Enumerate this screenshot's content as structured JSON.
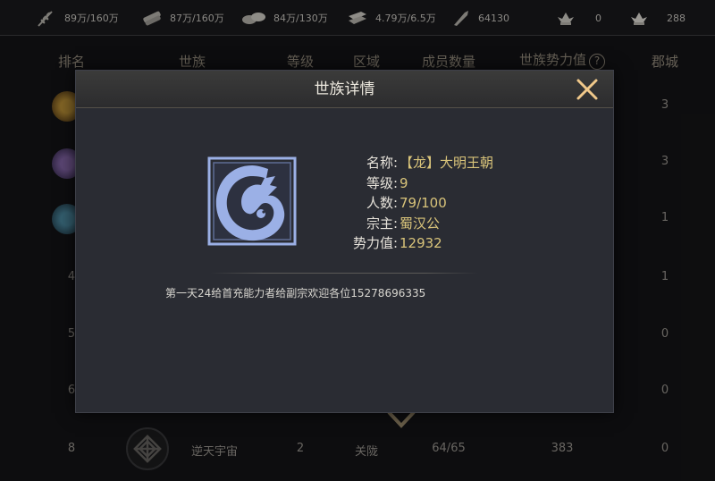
{
  "resources": [
    {
      "icon": "wheat-icon",
      "value": "89万/160万"
    },
    {
      "icon": "wood-icon",
      "value": "87万/160万"
    },
    {
      "icon": "stone-icon",
      "value": "84万/130万"
    },
    {
      "icon": "iron-icon",
      "value": "4.79万/6.5万"
    },
    {
      "icon": "order-icon",
      "value": "64130"
    },
    {
      "icon": "gold-icon",
      "value": "0"
    },
    {
      "icon": "silver-icon",
      "value": "288"
    }
  ],
  "table": {
    "headers": {
      "rank": "排名",
      "clan": "世族",
      "level": "等级",
      "region": "区域",
      "members": "成员数量",
      "power": "世族势力值",
      "cities": "郡城"
    },
    "help_symbol": "?",
    "rows": [
      {
        "rank": "",
        "cities": "3"
      },
      {
        "rank": "",
        "cities": "3"
      },
      {
        "rank": "",
        "cities": "1"
      },
      {
        "rank": "4",
        "cities": "1"
      },
      {
        "rank": "5",
        "cities": "0"
      },
      {
        "rank": "6",
        "cities": "0"
      },
      {
        "rank": "8",
        "clan": "逆天宇宙",
        "level": "2",
        "region": "关陇",
        "members": "64/65",
        "power": "383",
        "cities": "0"
      }
    ]
  },
  "modal": {
    "title": "世族详情",
    "info": {
      "name_label": "名称:",
      "name_value": "【龙】大明王朝",
      "level_label": "等级:",
      "level_value": "9",
      "count_label": "人数:",
      "count_value": "79/100",
      "leader_label": "宗主:",
      "leader_value": "蜀汉公",
      "power_label": "势力值:",
      "power_value": "12932"
    },
    "notice": "第一天24给首充能力者给副宗欢迎各位15278696335"
  },
  "colors": {
    "gold_text": "#d9c47a",
    "emblem_blue": "#9bb0e6",
    "close_orange": "#f0c88a"
  }
}
